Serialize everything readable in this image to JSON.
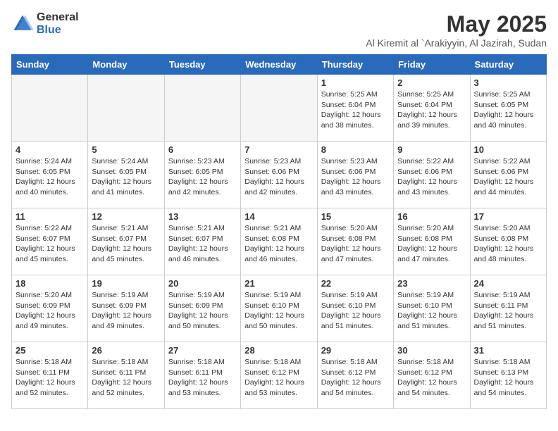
{
  "header": {
    "logo_general": "General",
    "logo_blue": "Blue",
    "month_title": "May 2025",
    "subtitle": "Al Kiremit al `Arakiyyin, Al Jazirah, Sudan"
  },
  "weekdays": [
    "Sunday",
    "Monday",
    "Tuesday",
    "Wednesday",
    "Thursday",
    "Friday",
    "Saturday"
  ],
  "weeks": [
    [
      {
        "day": "",
        "info": ""
      },
      {
        "day": "",
        "info": ""
      },
      {
        "day": "",
        "info": ""
      },
      {
        "day": "",
        "info": ""
      },
      {
        "day": "1",
        "info": "Sunrise: 5:25 AM\nSunset: 6:04 PM\nDaylight: 12 hours\nand 38 minutes."
      },
      {
        "day": "2",
        "info": "Sunrise: 5:25 AM\nSunset: 6:04 PM\nDaylight: 12 hours\nand 39 minutes."
      },
      {
        "day": "3",
        "info": "Sunrise: 5:25 AM\nSunset: 6:05 PM\nDaylight: 12 hours\nand 40 minutes."
      }
    ],
    [
      {
        "day": "4",
        "info": "Sunrise: 5:24 AM\nSunset: 6:05 PM\nDaylight: 12 hours\nand 40 minutes."
      },
      {
        "day": "5",
        "info": "Sunrise: 5:24 AM\nSunset: 6:05 PM\nDaylight: 12 hours\nand 41 minutes."
      },
      {
        "day": "6",
        "info": "Sunrise: 5:23 AM\nSunset: 6:05 PM\nDaylight: 12 hours\nand 42 minutes."
      },
      {
        "day": "7",
        "info": "Sunrise: 5:23 AM\nSunset: 6:06 PM\nDaylight: 12 hours\nand 42 minutes."
      },
      {
        "day": "8",
        "info": "Sunrise: 5:23 AM\nSunset: 6:06 PM\nDaylight: 12 hours\nand 43 minutes."
      },
      {
        "day": "9",
        "info": "Sunrise: 5:22 AM\nSunset: 6:06 PM\nDaylight: 12 hours\nand 43 minutes."
      },
      {
        "day": "10",
        "info": "Sunrise: 5:22 AM\nSunset: 6:06 PM\nDaylight: 12 hours\nand 44 minutes."
      }
    ],
    [
      {
        "day": "11",
        "info": "Sunrise: 5:22 AM\nSunset: 6:07 PM\nDaylight: 12 hours\nand 45 minutes."
      },
      {
        "day": "12",
        "info": "Sunrise: 5:21 AM\nSunset: 6:07 PM\nDaylight: 12 hours\nand 45 minutes."
      },
      {
        "day": "13",
        "info": "Sunrise: 5:21 AM\nSunset: 6:07 PM\nDaylight: 12 hours\nand 46 minutes."
      },
      {
        "day": "14",
        "info": "Sunrise: 5:21 AM\nSunset: 6:08 PM\nDaylight: 12 hours\nand 46 minutes."
      },
      {
        "day": "15",
        "info": "Sunrise: 5:20 AM\nSunset: 6:08 PM\nDaylight: 12 hours\nand 47 minutes."
      },
      {
        "day": "16",
        "info": "Sunrise: 5:20 AM\nSunset: 6:08 PM\nDaylight: 12 hours\nand 47 minutes."
      },
      {
        "day": "17",
        "info": "Sunrise: 5:20 AM\nSunset: 6:08 PM\nDaylight: 12 hours\nand 48 minutes."
      }
    ],
    [
      {
        "day": "18",
        "info": "Sunrise: 5:20 AM\nSunset: 6:09 PM\nDaylight: 12 hours\nand 49 minutes."
      },
      {
        "day": "19",
        "info": "Sunrise: 5:19 AM\nSunset: 6:09 PM\nDaylight: 12 hours\nand 49 minutes."
      },
      {
        "day": "20",
        "info": "Sunrise: 5:19 AM\nSunset: 6:09 PM\nDaylight: 12 hours\nand 50 minutes."
      },
      {
        "day": "21",
        "info": "Sunrise: 5:19 AM\nSunset: 6:10 PM\nDaylight: 12 hours\nand 50 minutes."
      },
      {
        "day": "22",
        "info": "Sunrise: 5:19 AM\nSunset: 6:10 PM\nDaylight: 12 hours\nand 51 minutes."
      },
      {
        "day": "23",
        "info": "Sunrise: 5:19 AM\nSunset: 6:10 PM\nDaylight: 12 hours\nand 51 minutes."
      },
      {
        "day": "24",
        "info": "Sunrise: 5:19 AM\nSunset: 6:11 PM\nDaylight: 12 hours\nand 51 minutes."
      }
    ],
    [
      {
        "day": "25",
        "info": "Sunrise: 5:18 AM\nSunset: 6:11 PM\nDaylight: 12 hours\nand 52 minutes."
      },
      {
        "day": "26",
        "info": "Sunrise: 5:18 AM\nSunset: 6:11 PM\nDaylight: 12 hours\nand 52 minutes."
      },
      {
        "day": "27",
        "info": "Sunrise: 5:18 AM\nSunset: 6:11 PM\nDaylight: 12 hours\nand 53 minutes."
      },
      {
        "day": "28",
        "info": "Sunrise: 5:18 AM\nSunset: 6:12 PM\nDaylight: 12 hours\nand 53 minutes."
      },
      {
        "day": "29",
        "info": "Sunrise: 5:18 AM\nSunset: 6:12 PM\nDaylight: 12 hours\nand 54 minutes."
      },
      {
        "day": "30",
        "info": "Sunrise: 5:18 AM\nSunset: 6:12 PM\nDaylight: 12 hours\nand 54 minutes."
      },
      {
        "day": "31",
        "info": "Sunrise: 5:18 AM\nSunset: 6:13 PM\nDaylight: 12 hours\nand 54 minutes."
      }
    ]
  ]
}
